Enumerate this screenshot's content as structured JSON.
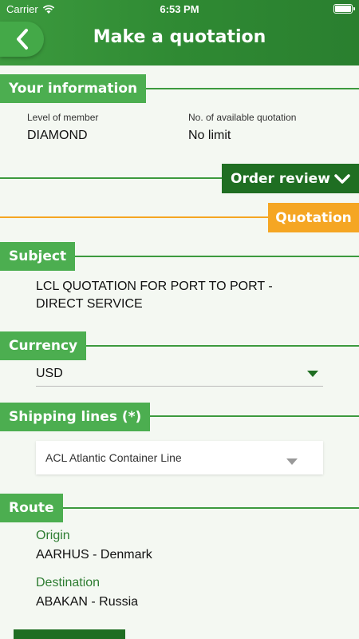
{
  "status_bar": {
    "carrier": "Carrier",
    "time": "6:53 PM"
  },
  "header": {
    "title": "Make a quotation"
  },
  "your_information": {
    "title": "Your information",
    "member_level_label": "Level of member",
    "member_level_value": "DIAMOND",
    "available_label": "No. of available quotation",
    "available_value": "No limit"
  },
  "order_review": {
    "label": "Order review"
  },
  "quotation_tab": {
    "label": "Quotation"
  },
  "subject": {
    "title": "Subject",
    "line1": "LCL QUOTATION FOR PORT TO PORT -",
    "line2": "DIRECT SERVICE"
  },
  "currency": {
    "title": "Currency",
    "value": "USD"
  },
  "shipping_lines": {
    "title": "Shipping lines (*)",
    "value": "ACL Atlantic Container Line"
  },
  "route": {
    "title": "Route",
    "origin_label": "Origin",
    "origin_value": "AARHUS - Denmark",
    "destination_label": "Destination",
    "destination_value": "ABAKAN - Russia"
  },
  "colors": {
    "header_green": "#2f8a33",
    "section_green": "#4cae50",
    "dark_green": "#1f6e22",
    "accent_orange": "#f5a623",
    "background": "#f4f8f2"
  },
  "icons": {
    "back": "chevron-left-icon",
    "order_review": "chevron-down-icon",
    "currency_dropdown": "caret-down-icon",
    "shipping_dropdown": "caret-down-icon",
    "status": [
      "wifi-icon",
      "battery-icon"
    ]
  }
}
